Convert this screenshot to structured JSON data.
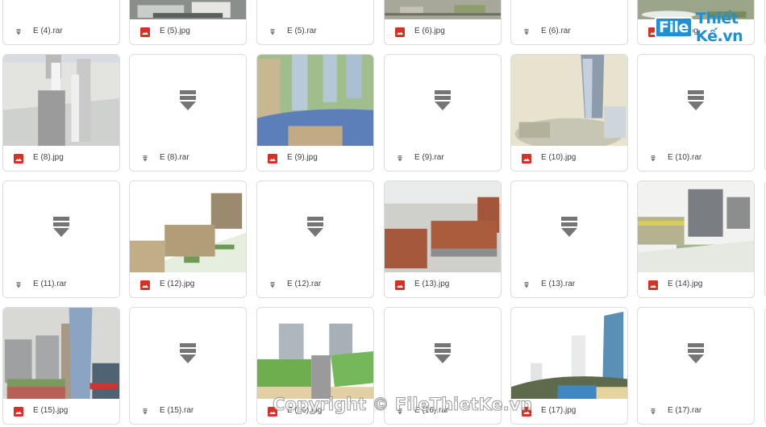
{
  "files": {
    "row0": [
      {
        "name": "E (4).rar",
        "type": "rar"
      },
      {
        "name": "E (5).jpg",
        "type": "jpg",
        "thumb": "aerial-grey"
      },
      {
        "name": "E (5).rar",
        "type": "rar"
      },
      {
        "name": "E (6).jpg",
        "type": "jpg",
        "thumb": "aerial-street"
      },
      {
        "name": "E (6).rar",
        "type": "rar"
      },
      {
        "name": "E (7).jpg",
        "type": "jpg",
        "thumb": "aerial-green"
      }
    ],
    "row1": [
      {
        "name": "E (8).jpg",
        "type": "jpg",
        "thumb": "grey-towers"
      },
      {
        "name": "E (8).rar",
        "type": "rar"
      },
      {
        "name": "E (9).jpg",
        "type": "jpg",
        "thumb": "blue-towers-green"
      },
      {
        "name": "E (9).rar",
        "type": "rar"
      },
      {
        "name": "E (10).jpg",
        "type": "jpg",
        "thumb": "tall-glass-tower"
      },
      {
        "name": "E (10).rar",
        "type": "rar"
      }
    ],
    "row2": [
      {
        "name": "E (11).rar",
        "type": "rar"
      },
      {
        "name": "E (12).jpg",
        "type": "jpg",
        "thumb": "beige-blocks"
      },
      {
        "name": "E (12).rar",
        "type": "rar"
      },
      {
        "name": "E (13).jpg",
        "type": "jpg",
        "thumb": "brick-blocks"
      },
      {
        "name": "E (13).rar",
        "type": "rar"
      },
      {
        "name": "E (14).jpg",
        "type": "jpg",
        "thumb": "grey-blocks"
      }
    ],
    "row3": [
      {
        "name": "E (15).jpg",
        "type": "jpg",
        "thumb": "mixed-towers"
      },
      {
        "name": "E (15).rar",
        "type": "rar"
      },
      {
        "name": "E (16).jpg",
        "type": "jpg",
        "thumb": "plaza-aerial"
      },
      {
        "name": "E (16).rar",
        "type": "rar"
      },
      {
        "name": "E (17).jpg",
        "type": "jpg",
        "thumb": "curved-tower"
      },
      {
        "name": "E (17).rar",
        "type": "rar"
      }
    ]
  },
  "icons": {
    "jpg": "image-file-icon",
    "rar": "archive-file-icon",
    "rar_thumb": "archive-download-icon"
  },
  "colors": {
    "image_icon": "#d93025",
    "archive_icon": "#757575",
    "card_border": "#dadce0",
    "text": "#3c4043"
  },
  "watermarks": {
    "logo_file": "File",
    "logo_rest": "Thiết Kế.vn",
    "copyright": "Copyright © FileThietKe.vn"
  }
}
